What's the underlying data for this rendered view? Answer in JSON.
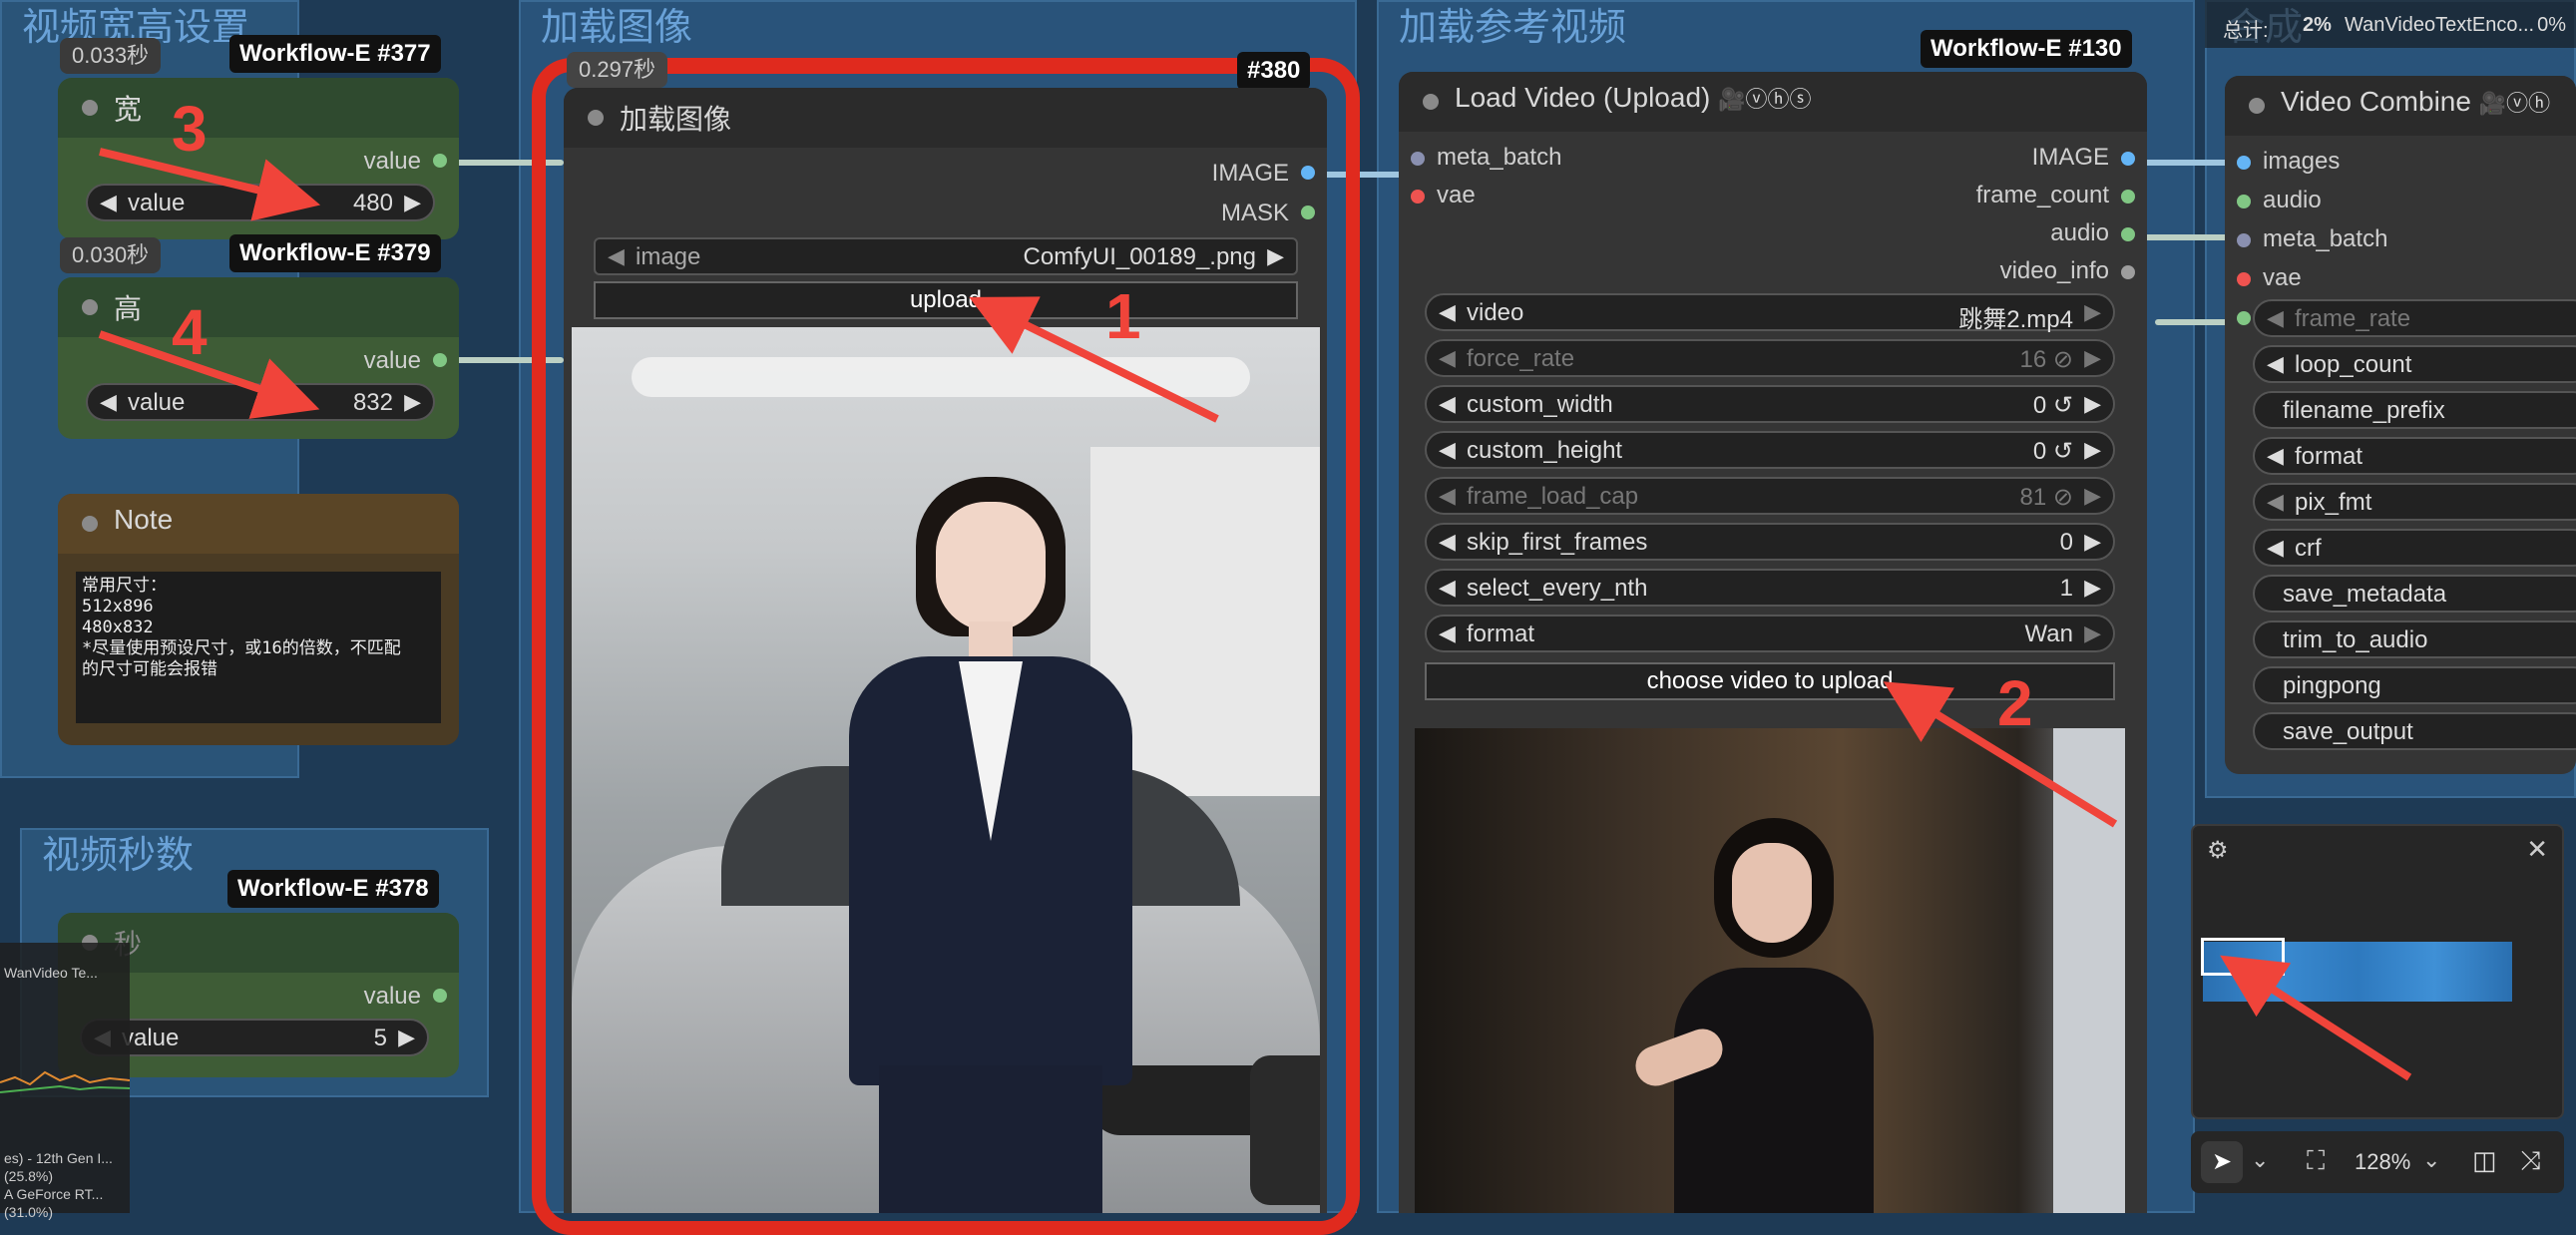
{
  "groups": {
    "size": "视频宽高设置",
    "load_image": "加载图像",
    "ref_video": "加载参考视频",
    "seconds": "视频秒数",
    "combine": "合成"
  },
  "width_node": {
    "time": "0.033秒",
    "badge": "Workflow-E",
    "id": "#377",
    "title": "宽",
    "out": "value",
    "widget_name": "value",
    "widget_value": "480"
  },
  "height_node": {
    "time": "0.030秒",
    "badge": "Workflow-E",
    "id": "#379",
    "title": "高",
    "out": "value",
    "widget_name": "value",
    "widget_value": "832"
  },
  "note_node": {
    "title": "Note",
    "lines": [
      "常用尺寸：",
      "512x896",
      "480x832",
      "*尽量使用预设尺寸，或16的倍数，不匹配",
      "的尺寸可能会报错"
    ]
  },
  "sec_node": {
    "badge": "Workflow-E",
    "id": "#378",
    "title": "秒",
    "out": "value",
    "widget_name": "value",
    "widget_value": "5"
  },
  "load_image_node": {
    "time": "0.297秒",
    "id": "#380",
    "title": "加载图像",
    "outputs": [
      "IMAGE",
      "MASK"
    ],
    "image_widget_name": "image",
    "image_widget_value": "ComfyUI_00189_.png",
    "upload_label": "upload"
  },
  "load_video_node": {
    "badge": "Workflow-E",
    "id": "#130",
    "title": "Load Video (Upload)",
    "vhs": "🎥ⓥⓗⓢ",
    "inputs": [
      "meta_batch",
      "vae"
    ],
    "outputs": [
      "IMAGE",
      "frame_count",
      "audio",
      "video_info"
    ],
    "widgets": [
      {
        "name": "video",
        "value": "跳舞2.mp4",
        "dim": false
      },
      {
        "name": "force_rate",
        "value": "16 ⊘",
        "dim": true
      },
      {
        "name": "custom_width",
        "value": "0 ↺",
        "dim": false
      },
      {
        "name": "custom_height",
        "value": "0 ↺",
        "dim": false
      },
      {
        "name": "frame_load_cap",
        "value": "81 ⊘",
        "dim": true
      },
      {
        "name": "skip_first_frames",
        "value": "0",
        "dim": false
      },
      {
        "name": "select_every_nth",
        "value": "1",
        "dim": false
      },
      {
        "name": "format",
        "value": "Wan",
        "dim": false
      }
    ],
    "upload_label": "choose video to upload"
  },
  "combine_node": {
    "title": "Video Combine",
    "vhs": "🎥ⓥⓗ",
    "inputs": [
      "images",
      "audio",
      "meta_batch",
      "vae"
    ],
    "widgets": [
      "frame_rate",
      "loop_count",
      "filename_prefix",
      "format",
      "pix_fmt",
      "crf",
      "save_metadata",
      "trim_to_audio",
      "pingpong",
      "save_output"
    ]
  },
  "top_status": {
    "label": "总计:",
    "pct": "2%",
    "task": "WanVideoTextEnco...",
    "pct2": "0%"
  },
  "side_status": {
    "lines": [
      "WanVideo Te...",
      "es) - 12th Gen I...",
      "(25.8%)",
      "A GeForce RT...",
      "(31.0%)"
    ]
  },
  "toolbar": {
    "zoom": "128%"
  },
  "annotations": [
    "1",
    "2",
    "3",
    "4"
  ],
  "colors": {
    "canvas": "#1e3a55",
    "group": "#2a5478",
    "highlight": "#e02a1e",
    "image_port": "#64b5f6",
    "mask_port": "#81c784",
    "vae_port": "#ef5350"
  }
}
